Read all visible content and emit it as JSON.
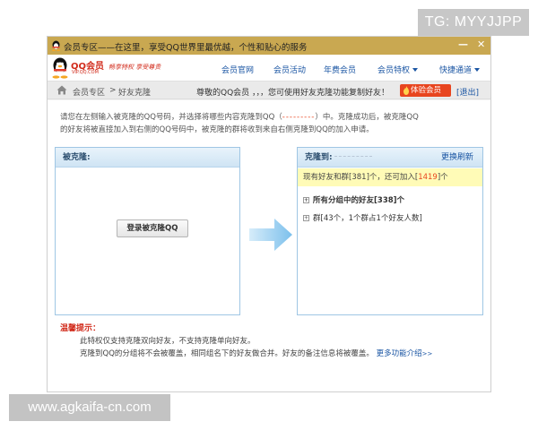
{
  "overlays": {
    "tg_tag": "TG: MYYJJPP",
    "site_url": "www.agkaifa-cn.com"
  },
  "window": {
    "title": "会员专区——在这里，享受QQ世界里最优越，个性和贴心的服务",
    "minimize_glyph": "—",
    "close_glyph": "✕"
  },
  "navbar": {
    "logo_text": "QQ会员",
    "logo_sub": "VIP.QQ.COM",
    "slogan": "畅享特权 享受尊贵",
    "items": [
      {
        "label": "会员官网",
        "dropdown": false
      },
      {
        "label": "会员活动",
        "dropdown": false
      },
      {
        "label": "年费会员",
        "dropdown": false
      },
      {
        "label": "会员特权",
        "dropdown": true
      },
      {
        "label": "快捷通道",
        "dropdown": true
      }
    ]
  },
  "breadcrumb": {
    "root": "会员专区",
    "separator": ">",
    "current": "好友克隆",
    "greeting": "尊敬的QQ会员 ，，，您可使用好友克隆功能复制好友！",
    "free_badge": "体验会员",
    "logout": "[退出]"
  },
  "intro": {
    "line1_a": "请您在左侧输入被克隆的QQ号码，并选择将哪些内容克隆到QQ（",
    "line1_redacted": "---------",
    "line1_b": "）中。克隆成功后，被克隆QQ",
    "line2": "的好友将被直接加入到右侧的QQ号码中，被克隆的群将收到来自右侧克隆到QQ的加入申请。"
  },
  "left_panel": {
    "header": "被克隆:",
    "login_button": "登录被克隆QQ"
  },
  "right_panel": {
    "header": "克隆到:",
    "refresh": "更换刷新",
    "stats_prefix": "现有好友和群[",
    "stats_count": "381",
    "stats_mid": "]个，还可加入[",
    "stats_remaining": "1419",
    "stats_suffix": "]个",
    "tree": [
      {
        "label": "所有分组中的好友",
        "count": "[338]个",
        "bold": true
      },
      {
        "label": "群",
        "count": "[43个，1个群占1个好友人数]",
        "bold": false
      }
    ]
  },
  "tips": {
    "title": "温馨提示：",
    "lines": [
      "此特权仅支持克隆双向好友，不支持克隆单向好友。",
      "克隆到QQ的分组将不会被覆盖，相同组名下的好友做合并。好友的备注信息将被覆盖。"
    ],
    "more_link": "更多功能介绍",
    "more_arrows": ">>"
  }
}
